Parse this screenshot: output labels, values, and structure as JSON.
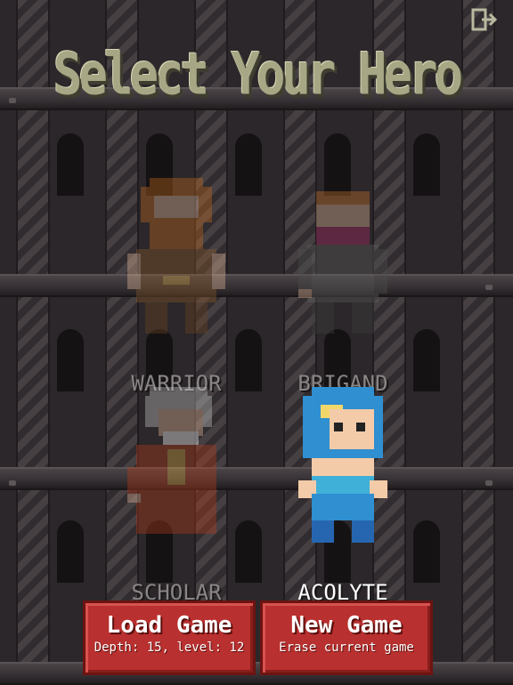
{
  "title": "Select Your Hero",
  "heroes": [
    {
      "label": "WARRIOR",
      "state": "dimmed"
    },
    {
      "label": "BRIGAND",
      "state": "dimmed"
    },
    {
      "label": "SCHOLAR",
      "state": "dimmed"
    },
    {
      "label": "ACOLYTE",
      "state": "selected"
    }
  ],
  "buttons": {
    "load": {
      "main": "Load Game",
      "sub": "Depth: 15, level: 12"
    },
    "new": {
      "main": "New Game",
      "sub": "Erase current game"
    }
  },
  "icons": {
    "exit": "exit-icon"
  },
  "colors": {
    "button": "#b8302f",
    "title": "#a7a785",
    "selected_label": "#ffffff",
    "dim_label": "#8a8585"
  }
}
